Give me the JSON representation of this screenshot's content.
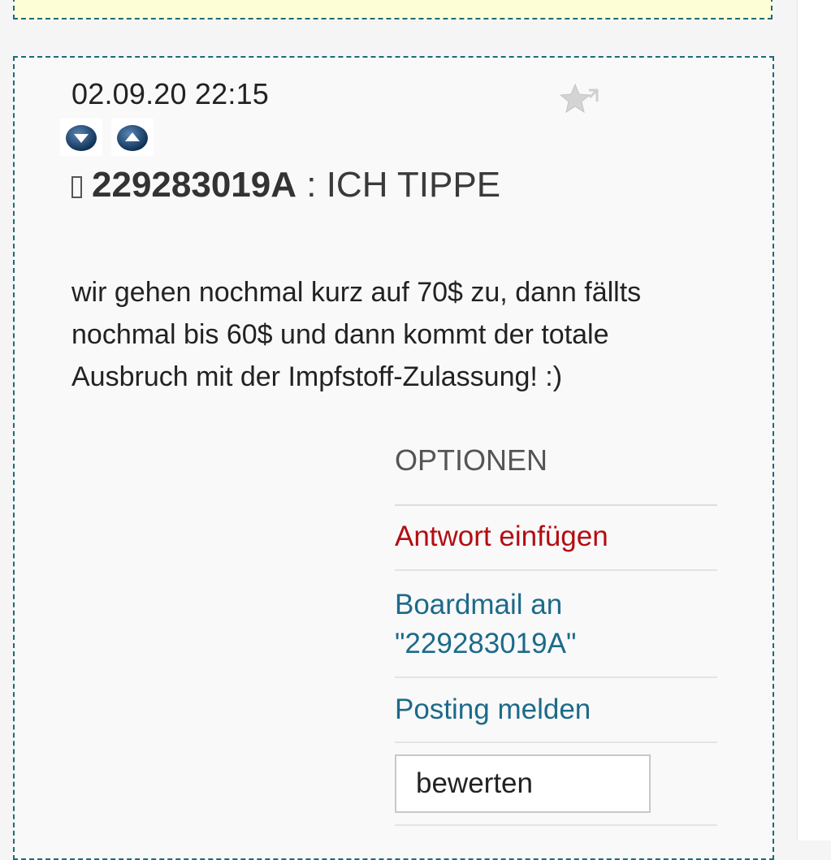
{
  "post": {
    "timestamp": "02.09.20 22:15",
    "author": "229283019A",
    "separator": " : ",
    "subject": "ICH TIPPE",
    "body": "wir gehen nochmal kurz auf 70$ zu, dann fällts nochmal bis 60$ und dann kommt der totale Ausbruch mit der Impfstoff-Zulassung! :)"
  },
  "icons": {
    "star": "star-add-icon",
    "vote_down": "arrow-down-icon",
    "vote_up": "arrow-up-icon",
    "user": "user-icon"
  },
  "options": {
    "title": "OPTIONEN",
    "reply_label": "Antwort einfügen",
    "boardmail_label": "Boardmail an \"229283019A\"",
    "report_label": "Posting melden",
    "rate_label": "bewerten"
  },
  "colors": {
    "post_border": "#1e6a7a",
    "reply_link": "#b30d12",
    "link": "#1c6a8a",
    "previous_post_background": "#fdfdd6"
  }
}
